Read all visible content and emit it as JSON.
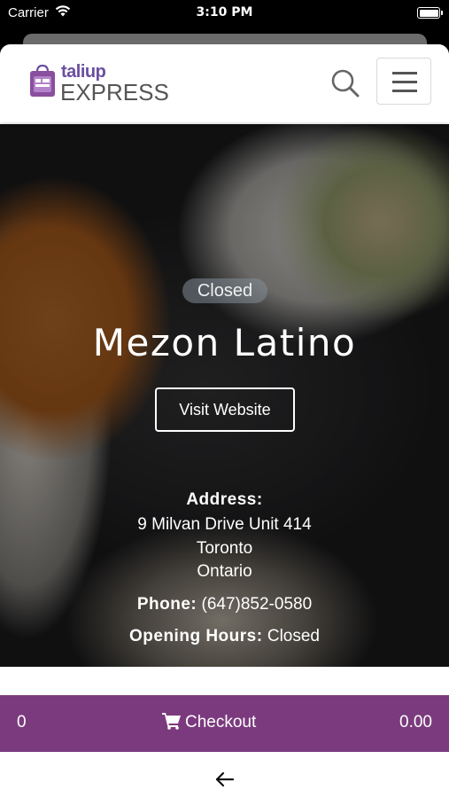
{
  "status_bar": {
    "carrier": "Carrier",
    "time": "3:10 PM",
    "wifi_icon": "wifi-icon",
    "battery_icon": "battery-icon"
  },
  "header": {
    "logo_word1": "taliup",
    "logo_word2": "EXPRESS",
    "search_icon": "search-icon",
    "menu_icon": "hamburger-menu-icon"
  },
  "restaurant": {
    "status": "Closed",
    "name": "Mezon Latino",
    "visit_label": "Visit Website",
    "address_label": "Address:",
    "address_line1": "9 Milvan Drive Unit 414",
    "address_line2": "Toronto",
    "address_line3": "Ontario",
    "phone_label": "Phone:",
    "phone_value": "(647)852-0580",
    "hours_label": "Opening Hours:",
    "hours_value": "Closed"
  },
  "checkout": {
    "count": "0",
    "label": "Checkout",
    "total": "0.00",
    "cart_icon": "cart-icon"
  },
  "nav": {
    "back_icon": "back-arrow-icon"
  },
  "colors": {
    "brand_purple": "#7b3a7e",
    "logo_purple": "#6a4fa0"
  }
}
